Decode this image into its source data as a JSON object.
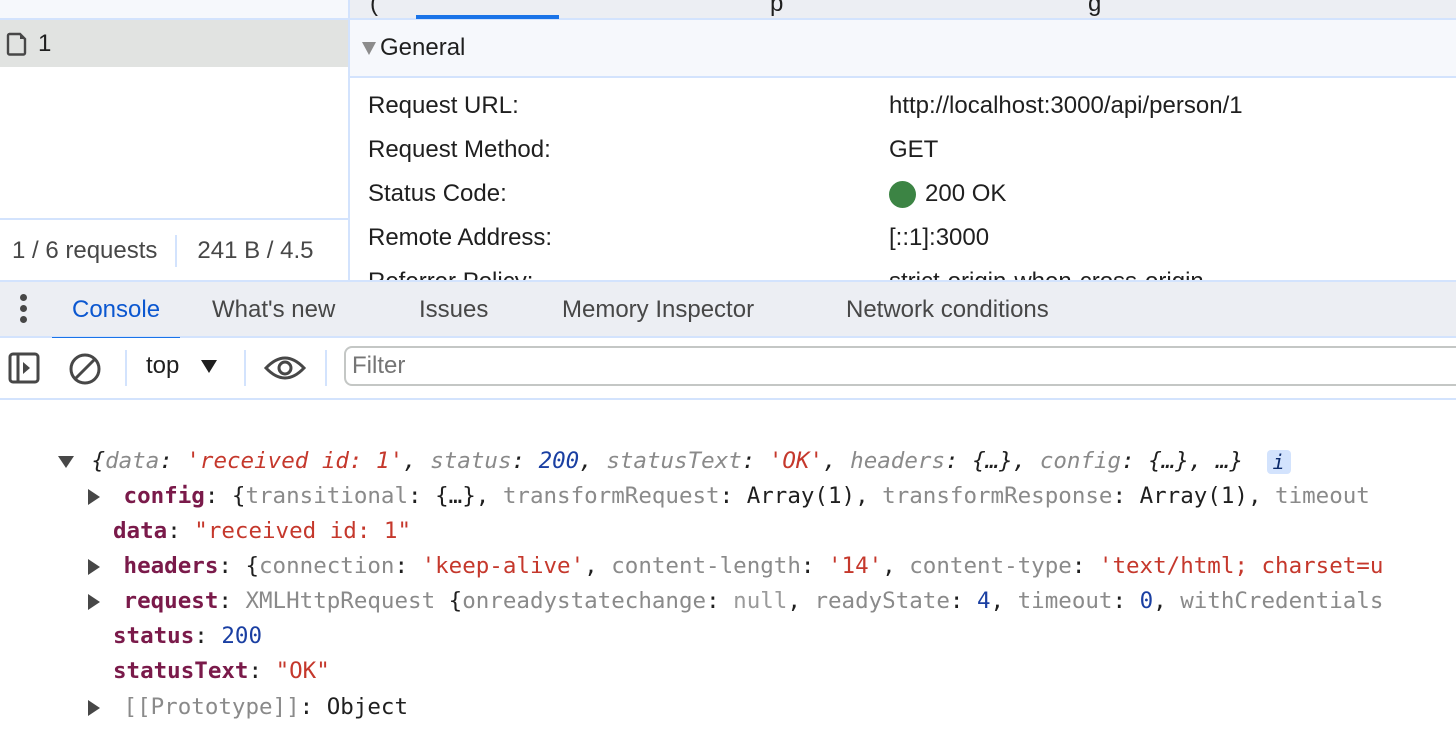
{
  "network": {
    "request_list": {
      "rows": [
        {
          "name": "1",
          "icon": "document-icon"
        }
      ],
      "summary": {
        "requests": "1 / 6 requests",
        "transferred": "241 B / 4.5"
      }
    },
    "details": {
      "tab_fragments": [
        "(",
        "p",
        "g"
      ],
      "section_title": "General",
      "rows": [
        {
          "key": "Request URL:",
          "value": "http://localhost:3000/api/person/1"
        },
        {
          "key": "Request Method:",
          "value": "GET"
        },
        {
          "key": "Status Code:",
          "value": "200 OK",
          "status_color": "#3c8444"
        },
        {
          "key": "Remote Address:",
          "value": "[::1]:3000"
        },
        {
          "key": "Referrer Policy:",
          "value": "strict-origin-when-cross-origin"
        }
      ]
    }
  },
  "drawer": {
    "tabs": [
      {
        "label": "Console",
        "active": true
      },
      {
        "label": "What's new",
        "active": false
      },
      {
        "label": "Issues",
        "active": false
      },
      {
        "label": "Memory Inspector",
        "active": false
      },
      {
        "label": "Network conditions",
        "active": false
      }
    ]
  },
  "console_toolbar": {
    "context": "top",
    "filter_placeholder": "Filter",
    "filter_value": ""
  },
  "console_output": {
    "summary": {
      "open": "{",
      "parts": [
        {
          "k": "data",
          "v": "'received id: 1'",
          "type": "str"
        },
        {
          "k": "status",
          "v": "200",
          "type": "num"
        },
        {
          "k": "statusText",
          "v": "'OK'",
          "type": "str"
        },
        {
          "k": "headers",
          "v": "{…}",
          "type": "obj"
        },
        {
          "k": "config",
          "v": "{…}",
          "type": "obj"
        }
      ],
      "tail": "…}",
      "info": "i"
    },
    "config": {
      "key": "config",
      "preview": [
        {
          "k": "transitional",
          "v": "{…}",
          "type": "obj"
        },
        {
          "k": "transformRequest",
          "v": "Array(1)",
          "type": "obj"
        },
        {
          "k": "transformResponse",
          "v": "Array(1)",
          "type": "obj"
        },
        {
          "k": "timeout",
          "v": "",
          "type": "cut"
        }
      ]
    },
    "data": {
      "key": "data",
      "value": "\"received id: 1\""
    },
    "headers": {
      "key": "headers",
      "preview": [
        {
          "k": "connection",
          "v": "'keep-alive'",
          "type": "str"
        },
        {
          "k": "content-length",
          "v": "'14'",
          "type": "str"
        },
        {
          "k": "content-type",
          "v": "'text/html; charset=u",
          "type": "str"
        }
      ]
    },
    "request": {
      "key": "request",
      "class_name": "XMLHttpRequest",
      "preview": [
        {
          "k": "onreadystatechange",
          "v": "null",
          "type": "null"
        },
        {
          "k": "readyState",
          "v": "4",
          "type": "num"
        },
        {
          "k": "timeout",
          "v": "0",
          "type": "num"
        },
        {
          "k": "withCredentials",
          "v": "",
          "type": "cut"
        }
      ]
    },
    "status": {
      "key": "status",
      "value": "200"
    },
    "statusText": {
      "key": "statusText",
      "value": "\"OK\""
    },
    "prototype": {
      "key": "[[Prototype]]",
      "value": "Object"
    }
  },
  "colors": {
    "accent": "#1a73e8",
    "active_tab_text": "#0b57d0",
    "panel_border": "#d3e3fd",
    "string": "#c5382c",
    "number": "#1a3fa2",
    "property_key": "#7a1a4a",
    "status_ok": "#3c8444"
  }
}
